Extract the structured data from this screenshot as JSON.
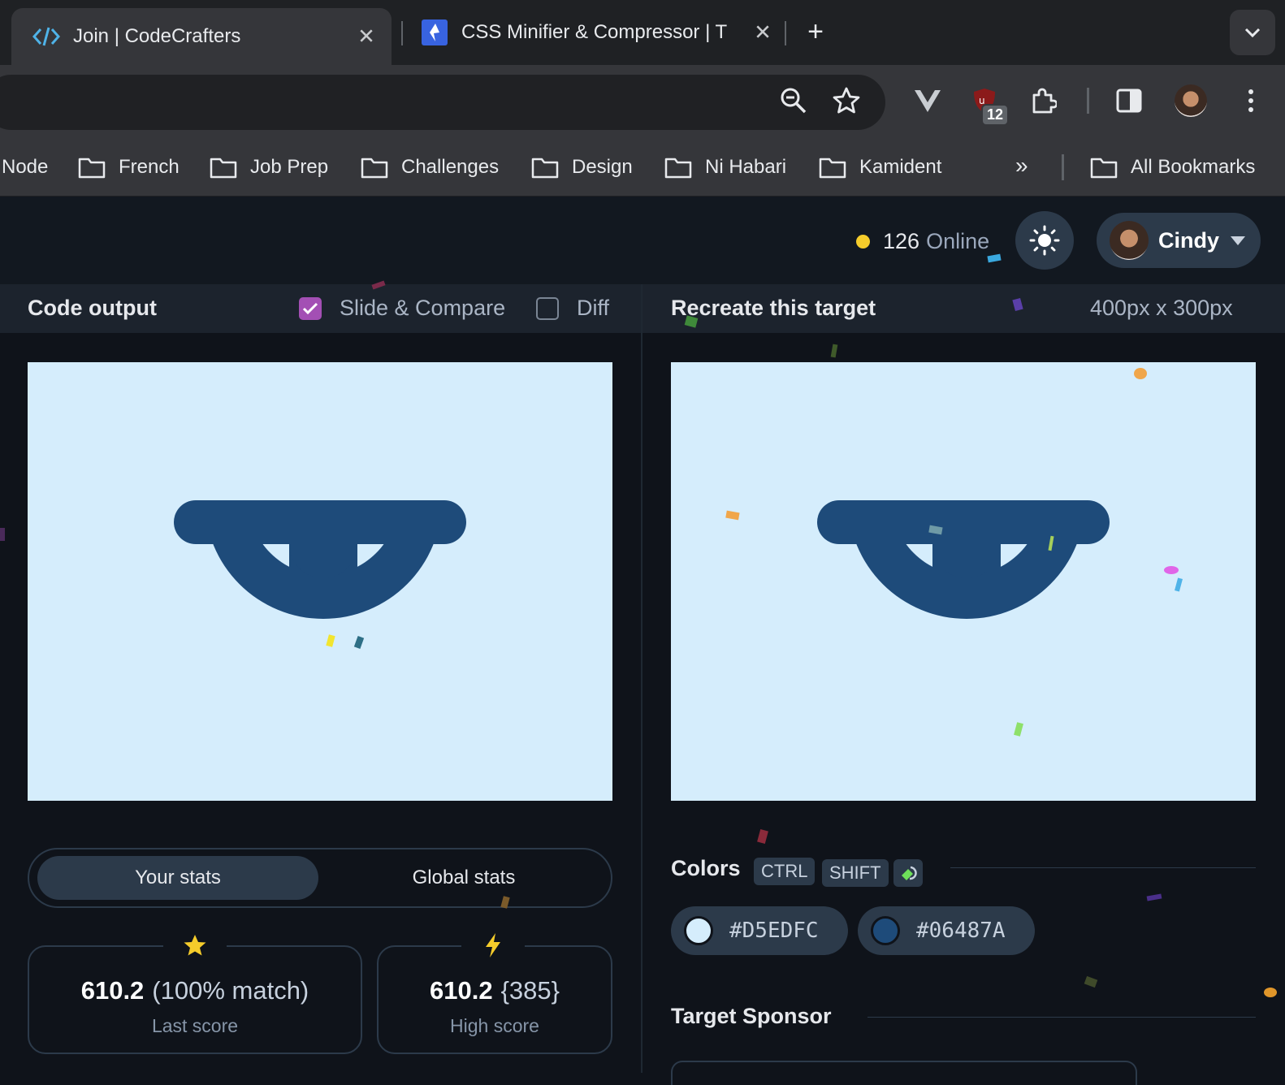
{
  "browser": {
    "tabs": [
      {
        "title": "Join | CodeCrafters",
        "active": true,
        "favicon": "code-brackets-icon"
      },
      {
        "title": "CSS Minifier & Compressor | T",
        "active": false,
        "favicon": "toptal-diamond-icon"
      }
    ],
    "new_tab_label": "+",
    "extension_badge": "12",
    "bookmarks": [
      "Node",
      "French",
      "Job Prep",
      "Challenges",
      "Design",
      "Ni Habari",
      "Kamident"
    ],
    "all_bookmarks": "All Bookmarks"
  },
  "header": {
    "online_count": "126",
    "online_label": "Online",
    "user_name": "Cindy"
  },
  "left_panel": {
    "title": "Code output",
    "slide_compare_label": "Slide & Compare",
    "slide_compare_checked": true,
    "diff_label": "Diff",
    "diff_checked": false
  },
  "right_panel": {
    "title": "Recreate this target",
    "dimensions": "400px x 300px"
  },
  "stats": {
    "your_stats": "Your stats",
    "global_stats": "Global stats",
    "last_score_value": "610.2",
    "last_score_match": "(100% match)",
    "last_score_label": "Last score",
    "high_score_value": "610.2",
    "high_score_rank": "{385}",
    "high_score_label": "High score"
  },
  "colors": {
    "title": "Colors",
    "shortcuts": [
      "CTRL",
      "SHIFT"
    ],
    "swatches": [
      {
        "hex": "#D5EDFC"
      },
      {
        "hex": "#06487A"
      }
    ]
  },
  "sponsor": {
    "title": "Target Sponsor"
  },
  "palette": {
    "canvas_bg": "#D5EDFC",
    "shape": "#1E4B7A",
    "accent": "#A34FB4",
    "online_dot": "#F5CC2B"
  }
}
